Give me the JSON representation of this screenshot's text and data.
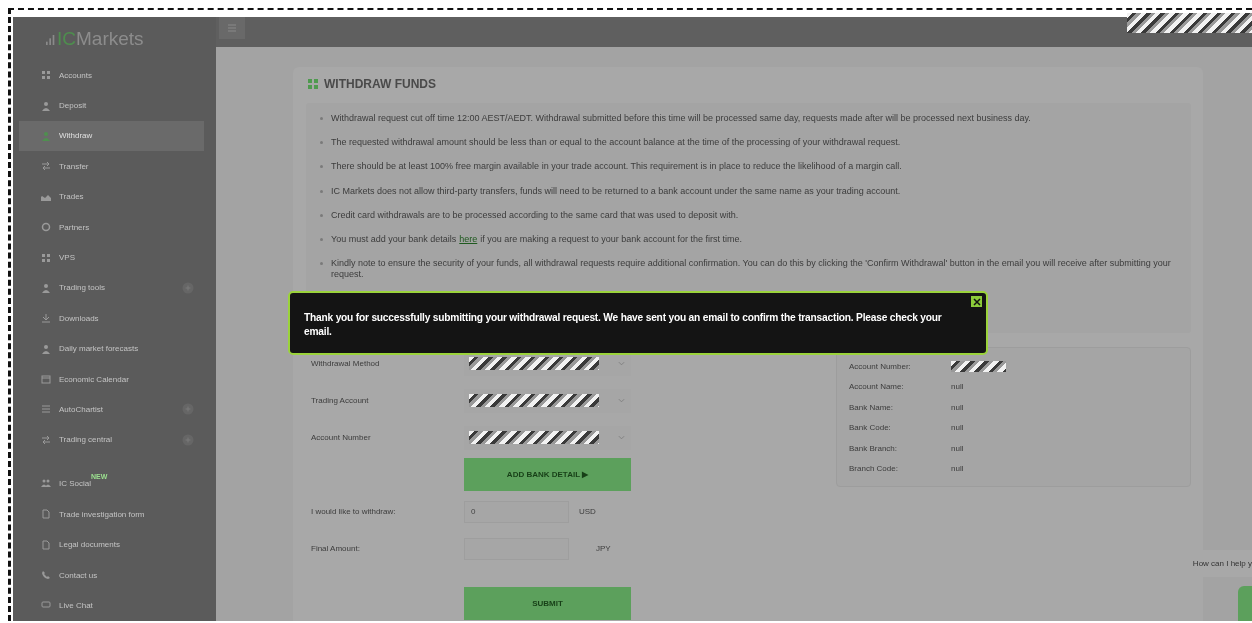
{
  "logo": {
    "accent": "IC",
    "text": "Markets"
  },
  "sidebar": {
    "items": [
      {
        "label": "Accounts",
        "selected": false
      },
      {
        "label": "Deposit",
        "selected": false
      },
      {
        "label": "Withdraw",
        "selected": true
      },
      {
        "label": "Transfer",
        "selected": false
      },
      {
        "label": "Trades",
        "selected": false
      },
      {
        "label": "Partners",
        "selected": false
      },
      {
        "label": "VPS",
        "selected": false
      },
      {
        "label": "Trading tools",
        "selected": false,
        "expandable": true
      },
      {
        "label": "Downloads",
        "selected": false
      },
      {
        "label": "Daily market forecasts",
        "selected": false
      },
      {
        "label": "Economic Calendar",
        "selected": false
      },
      {
        "label": "AutoChartist",
        "selected": false,
        "expandable": true
      },
      {
        "label": "Trading central",
        "selected": false,
        "expandable": true
      },
      {
        "label": "IC Social",
        "selected": false,
        "badge": "NEW"
      },
      {
        "label": "Trade investigation form",
        "selected": false
      },
      {
        "label": "Legal documents",
        "selected": false
      },
      {
        "label": "Contact us",
        "selected": false
      },
      {
        "label": "Live Chat",
        "selected": false
      }
    ]
  },
  "card": {
    "title": "WITHDRAW FUNDS",
    "notes": [
      {
        "text": "Withdrawal request cut off time 12:00 AEST/AEDT. Withdrawal submitted before this time will be processed same day, requests made after will be processed next business day."
      },
      {
        "text": "The requested withdrawal amount should be less than or equal to the account balance at the time of the processing of your withdrawal request."
      },
      {
        "text": "There should be at least 100% free margin available in your trade account. This requirement is in place to reduce the likelihood of a margin call."
      },
      {
        "text": "IC Markets does not allow third-party transfers, funds will need to be returned to a bank account under the same name as your trading account."
      },
      {
        "text": "Credit card withdrawals are to be processed according to the same card that was used to deposit with."
      },
      {
        "text": "You must add your bank details",
        "link": "here",
        "after": "if you are making a request to your bank account for the first time."
      },
      {
        "text": "Kindly note to ensure the security of your funds, all withdrawal requests require additional confirmation. You can do this by clicking the 'Confirm Withdrawal' button in the email you will receive after submitting your request."
      }
    ],
    "form": {
      "selects": [
        {
          "label": "Withdrawal Method",
          "redacted": true
        },
        {
          "label": "Trading Account",
          "redacted": true
        },
        {
          "label": "Account Number",
          "redacted": true
        }
      ],
      "add_bank_button": "ADD BANK DETAIL ▶",
      "amount": {
        "label": "I would like to withdraw:",
        "placeholder": "0",
        "currency": "USD"
      },
      "final": {
        "label": "Final Amount:",
        "currency": "JPY"
      },
      "submit": "SUBMIT"
    },
    "bank_details": [
      {
        "label": "Account Number:",
        "redacted": true
      },
      {
        "label": "Account Name:",
        "value": "null"
      },
      {
        "label": "Bank Name:",
        "value": "null"
      },
      {
        "label": "Bank Code:",
        "value": "null"
      },
      {
        "label": "Bank Branch:",
        "value": "null"
      },
      {
        "label": "Branch Code:",
        "value": "null"
      }
    ]
  },
  "toast": {
    "message": "Thank you for successfully submitting your withdrawal request. We have sent you an email to confirm the transaction. Please check your email."
  },
  "chat": {
    "bubble": "How can I help y"
  }
}
